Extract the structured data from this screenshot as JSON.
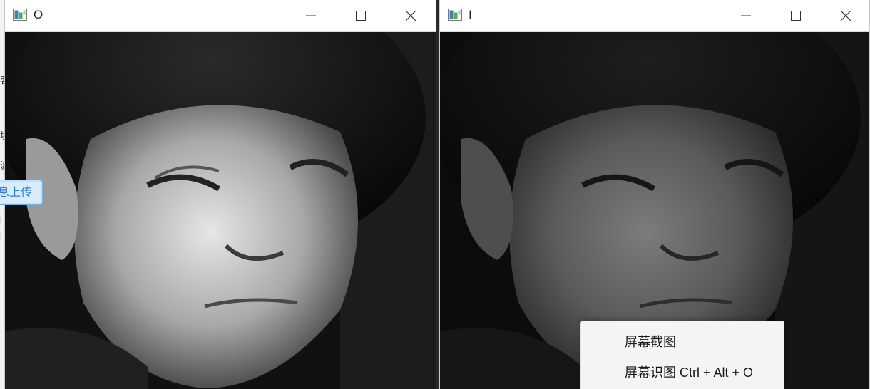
{
  "background_app": {
    "upload_button_label": "息上传",
    "glyphs": [
      "客",
      "块",
      "波",
      "l",
      "l"
    ]
  },
  "left_window": {
    "title": "O",
    "icon": "image-window-icon",
    "controls": [
      "minimize-icon",
      "maximize-icon",
      "close-icon"
    ],
    "image": "girl-portrait-high-contrast"
  },
  "right_window": {
    "title": "I",
    "icon": "image-window-icon",
    "controls": [
      "minimize-icon",
      "maximize-icon",
      "close-icon"
    ],
    "image": "girl-portrait-low-contrast"
  },
  "context_menu": {
    "items": [
      {
        "label": "屏幕截图"
      },
      {
        "label": "屏幕识图 Ctrl + Alt + O"
      }
    ]
  },
  "colors": {
    "upload_button_text": "#2b7dd6",
    "upload_button_border": "#6fb6ee",
    "menu_background": "#f4f4f4"
  }
}
